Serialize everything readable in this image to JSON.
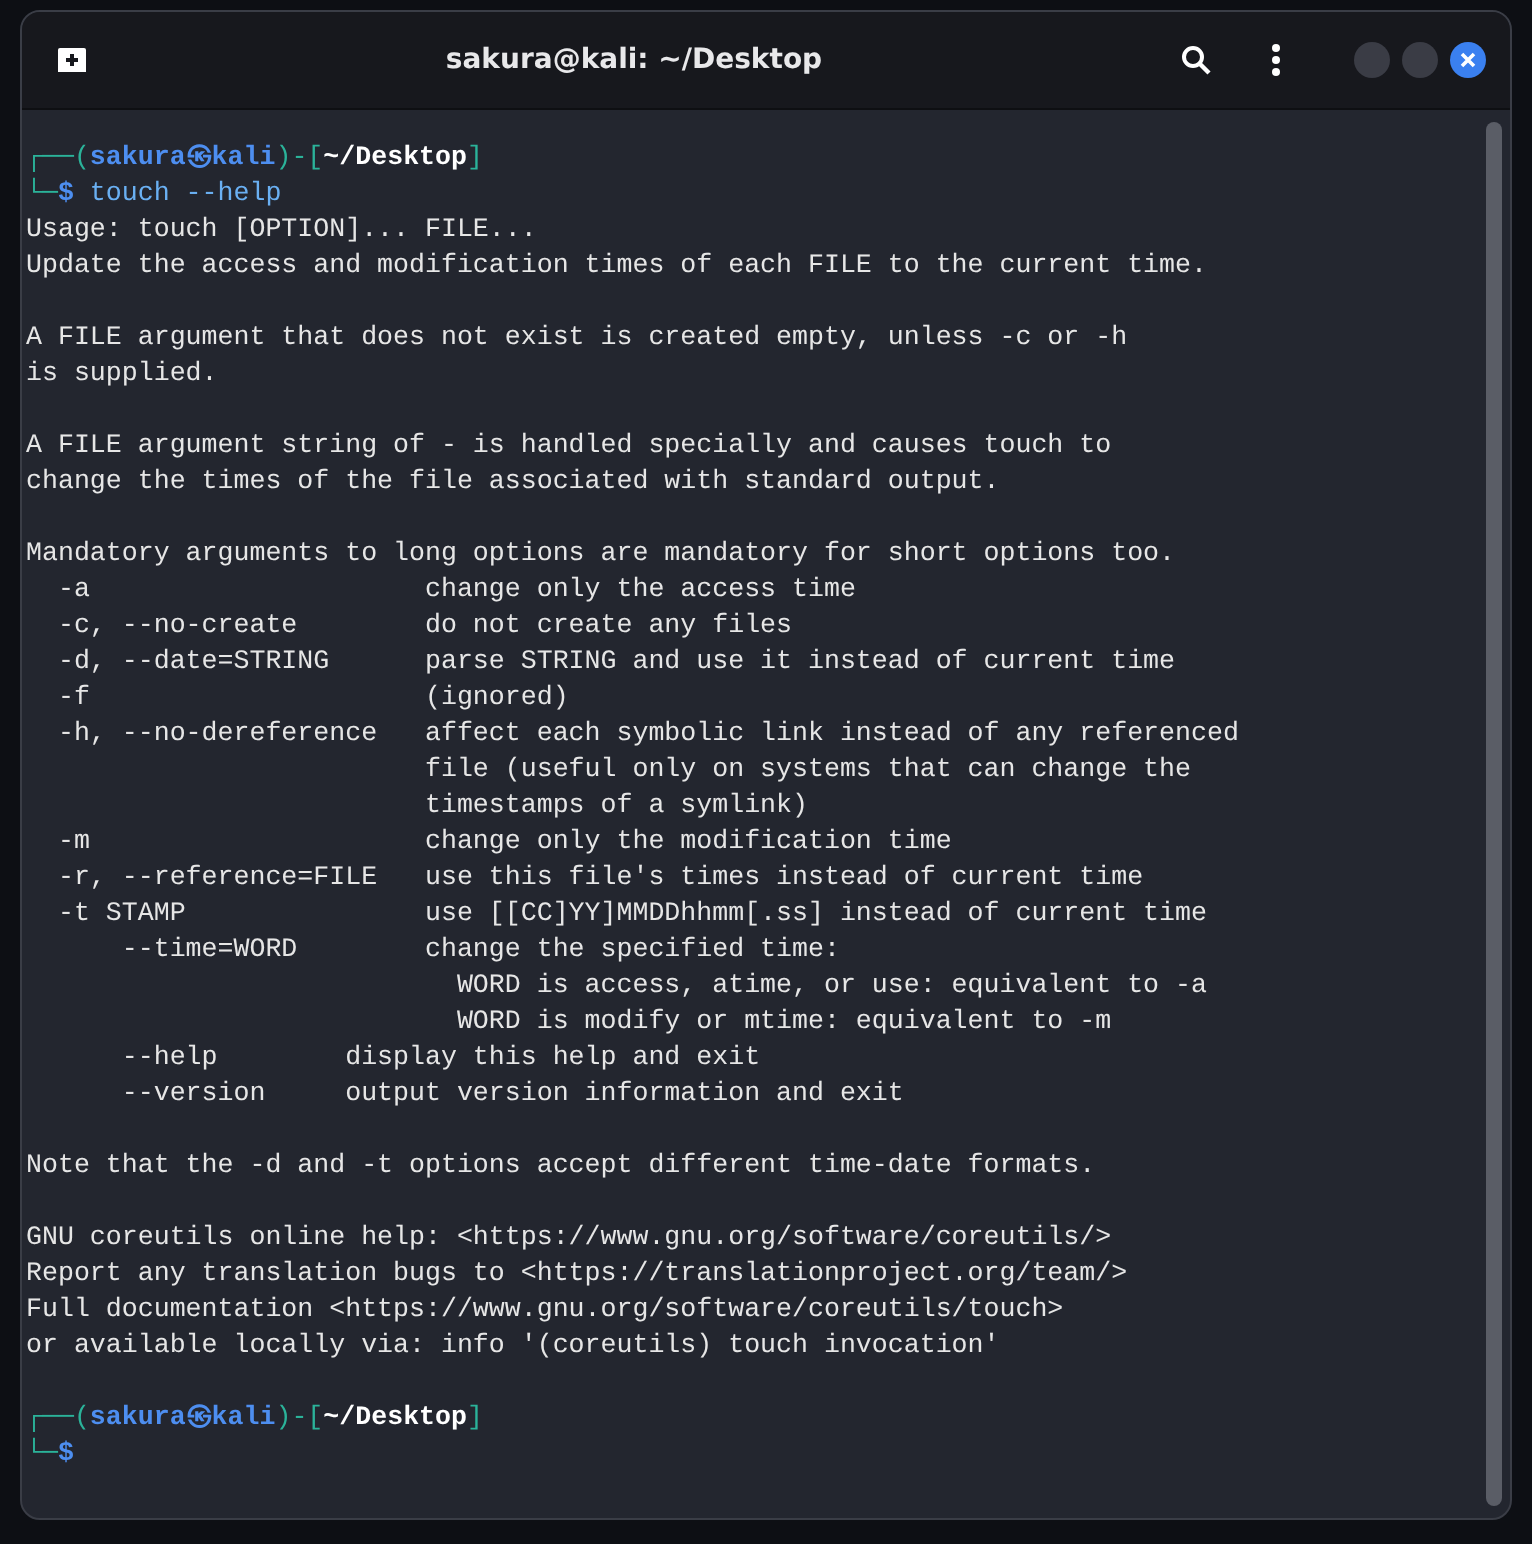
{
  "window": {
    "title": "sakura@kali: ~/Desktop"
  },
  "terminal": {
    "blocks": [
      {
        "kind": "prompt",
        "lines": [
          [
            {
              "text": "┌──(",
              "kind": "frame"
            },
            {
              "text": "sakura㉿kali",
              "kind": "user"
            },
            {
              "text": ")-[",
              "kind": "frame"
            },
            {
              "text": "~/Desktop",
              "kind": "path"
            },
            {
              "text": "]",
              "kind": "frame"
            }
          ],
          [
            {
              "text": "└─",
              "kind": "frame"
            },
            {
              "text": "$",
              "kind": "user"
            },
            {
              "text": " touch --help",
              "kind": "command"
            }
          ]
        ]
      },
      {
        "kind": "output",
        "paragraphs": [
          [
            "Usage: touch [OPTION]... FILE...",
            "Update the access and modification times of each FILE to the current time."
          ],
          [
            "A FILE argument that does not exist is created empty, unless -c or -h",
            "is supplied."
          ],
          [
            "A FILE argument string of - is handled specially and causes touch to",
            "change the times of the file associated with standard output."
          ],
          [
            "Mandatory arguments to long options are mandatory for short options too.",
            "  -a                     change only the access time",
            "  -c, --no-create        do not create any files",
            "  -d, --date=STRING      parse STRING and use it instead of current time",
            "  -f                     (ignored)",
            "  -h, --no-dereference   affect each symbolic link instead of any referenced",
            "                         file (useful only on systems that can change the",
            "                         timestamps of a symlink)",
            "  -m                     change only the modification time",
            "  -r, --reference=FILE   use this file's times instead of current time",
            "  -t STAMP               use [[CC]YY]MMDDhhmm[.ss] instead of current time",
            "      --time=WORD        change the specified time:",
            "                           WORD is access, atime, or use: equivalent to -a",
            "                           WORD is modify or mtime: equivalent to -m",
            "      --help        display this help and exit",
            "      --version     output version information and exit"
          ],
          [
            "Note that the -d and -t options accept different time-date formats."
          ],
          [
            "GNU coreutils online help: <https://www.gnu.org/software/coreutils/>",
            "Report any translation bugs to <https://translationproject.org/team/>",
            "Full documentation <https://www.gnu.org/software/coreutils/touch>",
            "or available locally via: info '(coreutils) touch invocation'"
          ]
        ]
      },
      {
        "kind": "prompt",
        "lines": [
          [
            {
              "text": "┌──(",
              "kind": "frame"
            },
            {
              "text": "sakura㉿kali",
              "kind": "user"
            },
            {
              "text": ")-[",
              "kind": "frame"
            },
            {
              "text": "~/Desktop",
              "kind": "path"
            },
            {
              "text": "]",
              "kind": "frame"
            }
          ],
          [
            {
              "text": "└─",
              "kind": "frame"
            },
            {
              "text": "$",
              "kind": "user"
            }
          ]
        ]
      }
    ]
  }
}
